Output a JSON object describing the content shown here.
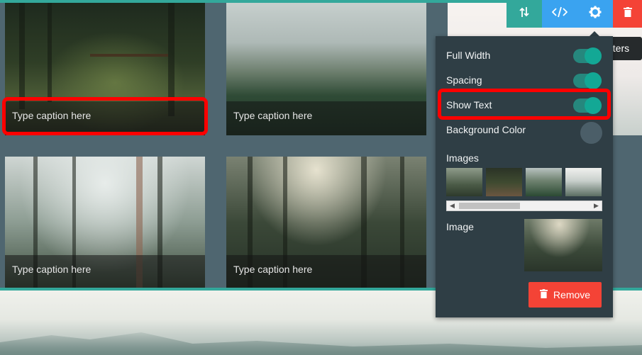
{
  "gallery": {
    "cards": [
      {
        "caption": "Type caption here"
      },
      {
        "caption": "Type caption here"
      },
      {
        "caption": "Type caption here"
      },
      {
        "caption": "Type caption here"
      }
    ]
  },
  "toolbar": {
    "buttons": [
      {
        "icon": "move-arrows-icon"
      },
      {
        "icon": "code-icon"
      },
      {
        "icon": "gear-icon"
      },
      {
        "icon": "trash-icon"
      }
    ],
    "tooltip": "eters"
  },
  "settings_panel": {
    "full_width_label": "Full Width",
    "full_width_on": true,
    "spacing_label": "Spacing",
    "spacing_on": true,
    "show_text_label": "Show Text",
    "show_text_on": true,
    "background_color_label": "Background Color",
    "background_color": "#4b5e68",
    "images_label": "Images",
    "image_label": "Image",
    "remove_label": "Remove"
  },
  "colors": {
    "accent_teal": "#33a89b",
    "toolbar_blue": "#3aa3f0",
    "danger_red": "#f44336",
    "panel_bg": "#2f3e45",
    "highlight": "#ff0000"
  }
}
